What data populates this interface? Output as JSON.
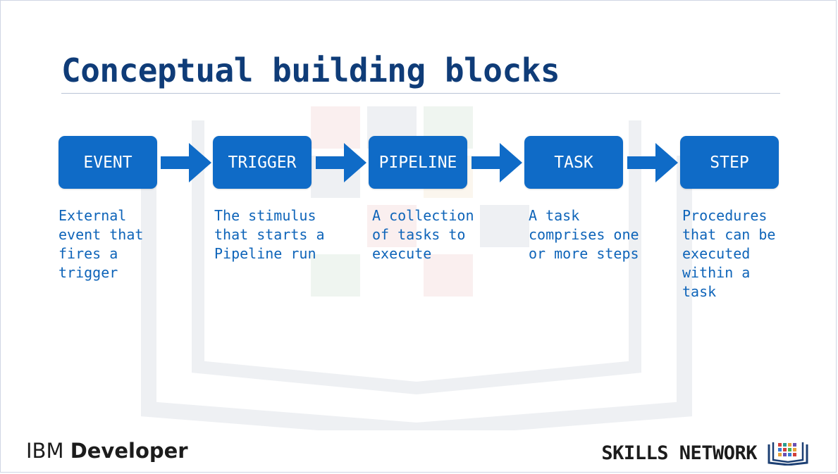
{
  "title": "Conceptual building blocks",
  "blocks": [
    {
      "label": "EVENT",
      "description": "External\nevent that\nfires a\ntrigger"
    },
    {
      "label": "TRIGGER",
      "description": "The stimulus\nthat starts a\nPipeline run"
    },
    {
      "label": "PIPELINE",
      "description": "A collection\nof tasks to\nexecute"
    },
    {
      "label": "TASK",
      "description": "A task\ncomprises one\nor more steps"
    },
    {
      "label": "STEP",
      "description": "Procedures\nthat can be\nexecuted\nwithin a\ntask"
    }
  ],
  "footer": {
    "brand_light": "IBM ",
    "brand_bold": "Developer",
    "skills_network": "SKILLS NETWORK",
    "skills_icon": "book-grid-icon"
  },
  "colors": {
    "title": "#0f3c78",
    "block": "#0f6bc7",
    "description": "#0e64b9"
  }
}
